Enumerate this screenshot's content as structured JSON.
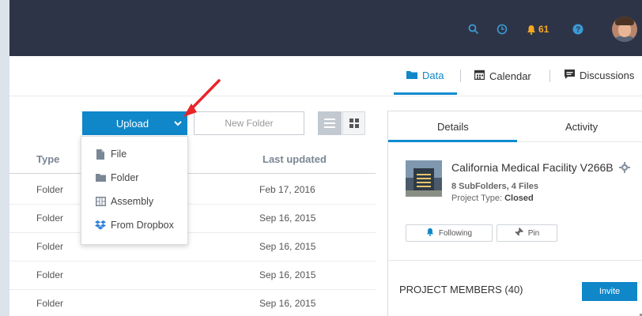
{
  "topbar": {
    "icons": [
      "search-icon",
      "clock-icon",
      "bell-icon",
      "help-icon",
      "avatar"
    ],
    "notification_count": "61",
    "colors": {
      "background": "#2e3447",
      "accent": "#f5a623",
      "icon": "#3a9bd5"
    }
  },
  "project_tabs": [
    {
      "label": "Data",
      "icon": "folder-icon",
      "active": true
    },
    {
      "label": "Calendar",
      "icon": "calendar-icon",
      "active": false
    },
    {
      "label": "Discussions",
      "icon": "chat-icon",
      "active": false
    }
  ],
  "toolbar": {
    "upload_label": "Upload",
    "new_folder_placeholder": "New Folder"
  },
  "upload_menu": [
    {
      "label": "File",
      "icon": "file-icon"
    },
    {
      "label": "Folder",
      "icon": "folder-icon"
    },
    {
      "label": "Assembly",
      "icon": "assembly-icon"
    },
    {
      "label": "From Dropbox",
      "icon": "dropbox-icon"
    }
  ],
  "table": {
    "columns": [
      "Type",
      "Last updated"
    ],
    "rows": [
      {
        "type": "Folder",
        "last_updated": "Feb 17, 2016"
      },
      {
        "type": "Folder",
        "last_updated": "Sep 16, 2015"
      },
      {
        "type": "Folder",
        "last_updated": "Sep 16, 2015"
      },
      {
        "type": "Folder",
        "last_updated": "Sep 16, 2015"
      },
      {
        "type": "Folder",
        "last_updated": "Sep 16, 2015"
      }
    ]
  },
  "details_panel": {
    "tabs": [
      {
        "label": "Details",
        "active": true
      },
      {
        "label": "Activity",
        "active": false
      }
    ],
    "project": {
      "title": "California Medical Facility V266B",
      "subfolders": "8 SubFolders, 4 Files",
      "type_label": "Project Type: ",
      "type_value": "Closed"
    },
    "following_label": "Following",
    "pin_label": "Pin",
    "members_label": "PROJECT MEMBERS (40)",
    "invite_label": "Invite"
  },
  "colors": {
    "primary": "#0f87c9",
    "annotation_arrow": "#e8252a"
  }
}
